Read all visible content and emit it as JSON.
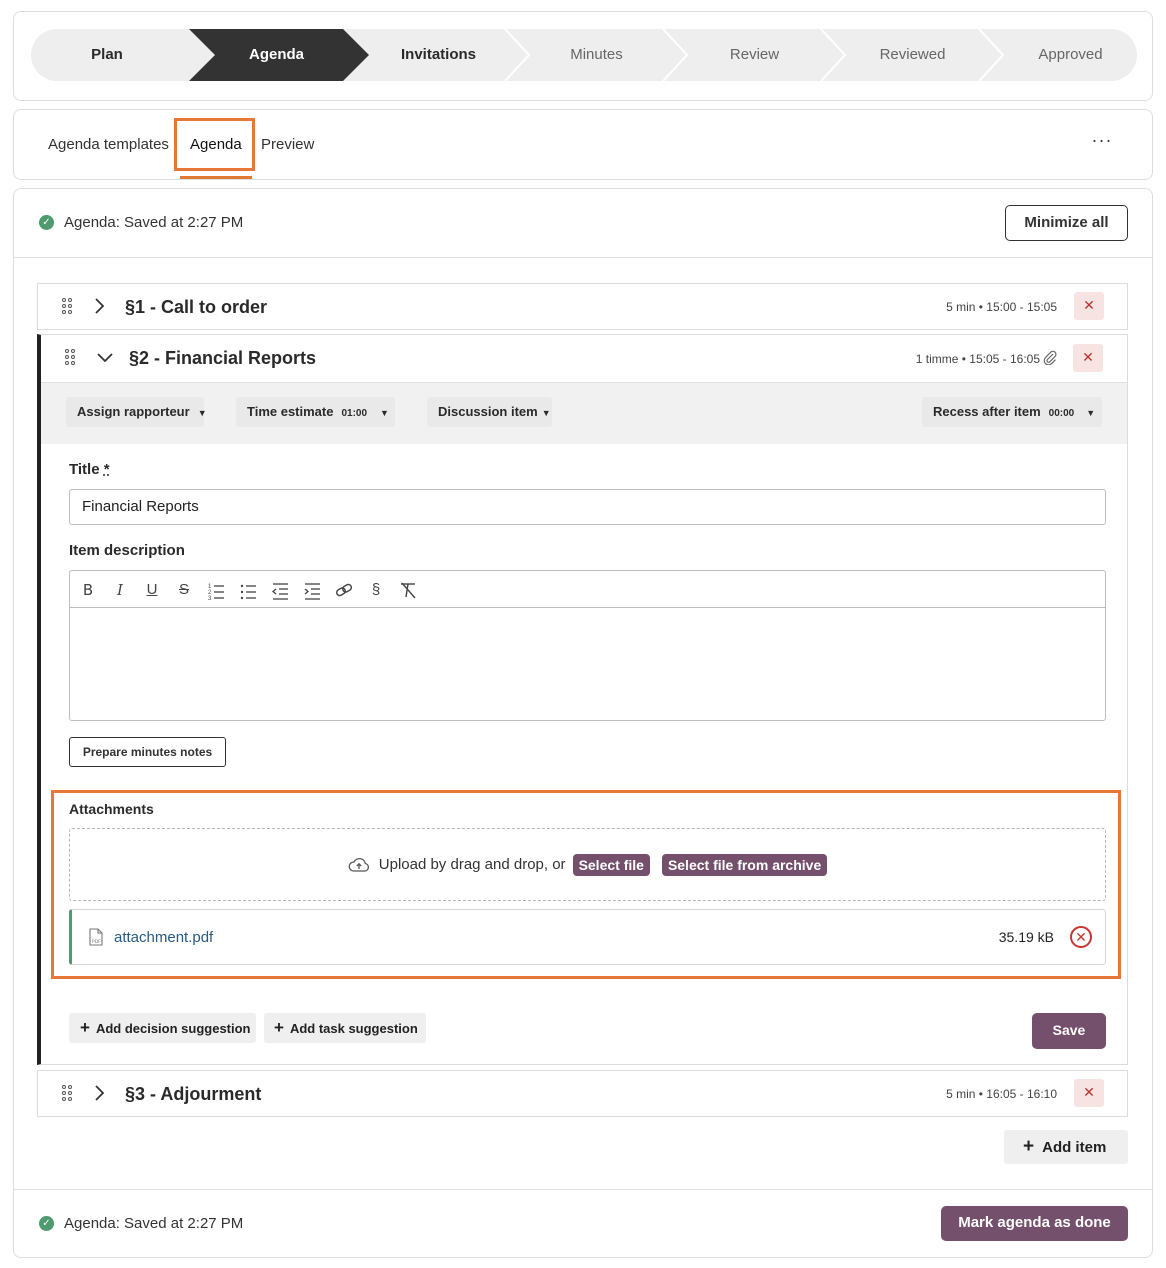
{
  "stepper": {
    "steps": [
      {
        "label": "Plan",
        "state": "done"
      },
      {
        "label": "Agenda",
        "state": "current"
      },
      {
        "label": "Invitations",
        "state": "done"
      },
      {
        "label": "Minutes",
        "state": "future"
      },
      {
        "label": "Review",
        "state": "future"
      },
      {
        "label": "Reviewed",
        "state": "future"
      },
      {
        "label": "Approved",
        "state": "future"
      }
    ]
  },
  "tabs": {
    "items": [
      "Agenda templates",
      "Agenda",
      "Preview"
    ],
    "active": "Agenda",
    "more_icon": "ellipsis-icon",
    "more_label": "···"
  },
  "main": {
    "saved_status": "Agenda: Saved at 2:27 PM",
    "minimize_all_label": "Minimize all",
    "items": [
      {
        "title": "§1 - Call to order",
        "time": "5 min • 15:00 - 15:05",
        "expanded": false
      },
      {
        "title": "§2 - Financial Reports",
        "time": "1 timme • 15:05 - 16:05",
        "expanded": true,
        "has_attachment": true
      },
      {
        "title": "§3 - Adjourment",
        "time": "5 min • 16:05 - 16:10",
        "expanded": false
      }
    ],
    "delete_symbol": "✕",
    "options": {
      "assign_rapporteur": "Assign rapporteur",
      "time_estimate_label": "Time estimate",
      "time_estimate_value": "01:00",
      "discussion_item": "Discussion item",
      "recess_label": "Recess after item",
      "recess_value": "00:00"
    },
    "title_label": "Title",
    "title_required_mark": "*",
    "title_value": "Financial Reports",
    "description_label": "Item description",
    "toolbar": [
      "bold",
      "italic",
      "underline",
      "strikethrough",
      "ordered-list",
      "bullet-list",
      "outdent",
      "indent",
      "link",
      "section",
      "clear-format"
    ],
    "prepare_minutes_label": "Prepare minutes notes",
    "attachments": {
      "label": "Attachments",
      "upload_text": "Upload by drag and drop, or",
      "select_file": "Select file",
      "select_archive": "Select file from archive",
      "file_name": "attachment.pdf",
      "file_size": "35.19 kB"
    },
    "add_decision_label": "Add decision suggestion",
    "add_task_label": "Add task suggestion",
    "save_label": "Save",
    "add_item_label": "Add item",
    "footer_status": "Agenda: Saved at 2:27 PM",
    "mark_done_label": "Mark agenda as done"
  },
  "colors": {
    "accent_dark": "#333333",
    "primary": "#74506c",
    "success": "#4f9a6e",
    "danger": "#cc3333",
    "highlight": "#e8773a"
  }
}
